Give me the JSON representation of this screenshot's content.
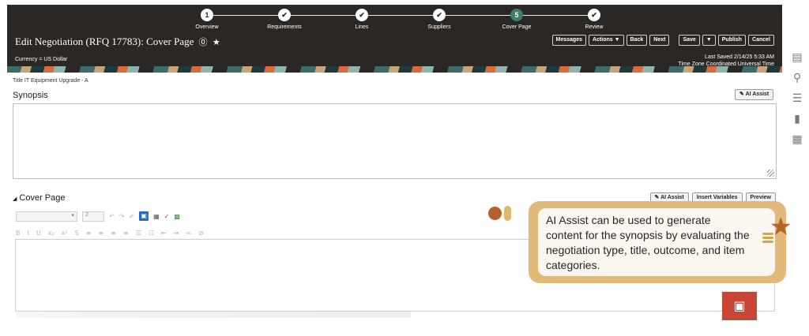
{
  "train": {
    "stops": [
      {
        "marker": "1",
        "label": "Overview"
      },
      {
        "marker": "✔",
        "label": "Requirements"
      },
      {
        "marker": "✔",
        "label": "Lines"
      },
      {
        "marker": "✔",
        "label": "Suppliers"
      },
      {
        "marker": "5",
        "label": "Cover Page"
      },
      {
        "marker": "✔",
        "label": "Review"
      }
    ]
  },
  "header": {
    "title": "Edit Negotiation (RFQ 17783): Cover Page",
    "help_glyph": "⓪",
    "star_glyph": "★",
    "currency": "Currency = US Dollar",
    "buttons": {
      "messages": "Messages",
      "actions": "Actions ▼",
      "back": "Back",
      "next": "Next",
      "save": "Save",
      "save_menu": "▼",
      "publish": "Publish",
      "cancel": "Cancel"
    },
    "last_saved": "Last Saved 2/14/25 5:33 AM",
    "timezone": "Time Zone Coordinated Universal Time"
  },
  "content": {
    "title_line": "Title  IT Equipment Upgrade - A",
    "synopsis_label": "Synopsis",
    "ai_assist": "AI Assist",
    "cover_page_label": "Cover Page",
    "insert_variables": "Insert Variables",
    "preview": "Preview",
    "editor_font_size": "2"
  },
  "callout": {
    "text": "AI Assist can be used to generate content for the synopsis by evaluating the negotiation type, title, outcome, and item categories."
  },
  "icons": [
    "document-icon",
    "search-icon",
    "list-icon",
    "chart-icon",
    "calendar-icon",
    "chat-icon",
    "star-icon"
  ],
  "colors": {
    "header_bg": "#2b2724",
    "active_stop": "#3e7d6c",
    "callout_border": "#e2b97a",
    "chat_button": "#c74634"
  }
}
